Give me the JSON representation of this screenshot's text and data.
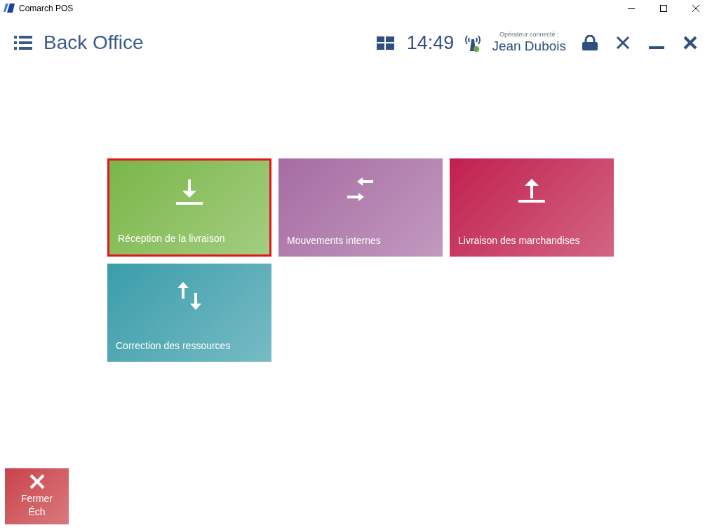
{
  "window": {
    "title": "Comarch POS"
  },
  "header": {
    "title": "Back Office",
    "time": "14:49",
    "operator_label": "Opérateur connecté :",
    "operator_name": "Jean Dubois"
  },
  "tiles": [
    {
      "label": "Réception de la livraison",
      "kind": "download",
      "color": "#7ab648",
      "selected": true
    },
    {
      "label": "Mouvements internes",
      "kind": "exchange",
      "color": "#a66ca2",
      "selected": false
    },
    {
      "label": "Livraison des marchandises",
      "kind": "upload",
      "color": "#c0204c",
      "selected": false
    },
    {
      "label": "Correction des ressources",
      "kind": "updown",
      "color": "#3a9daa",
      "selected": false
    }
  ],
  "footer_button": {
    "line_1": "Fermer",
    "line_2": "Éch"
  }
}
